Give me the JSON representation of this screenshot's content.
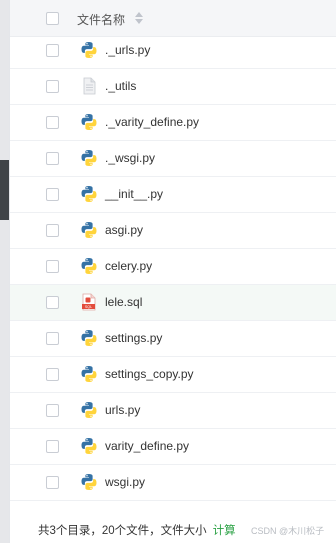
{
  "header": {
    "column_title": "文件名称"
  },
  "files": [
    {
      "name": "._urls.py",
      "type": "python"
    },
    {
      "name": "._utils",
      "type": "generic"
    },
    {
      "name": "._varity_define.py",
      "type": "python"
    },
    {
      "name": "._wsgi.py",
      "type": "python"
    },
    {
      "name": "__init__.py",
      "type": "python"
    },
    {
      "name": "asgi.py",
      "type": "python"
    },
    {
      "name": "celery.py",
      "type": "python"
    },
    {
      "name": "lele.sql",
      "type": "sql"
    },
    {
      "name": "settings.py",
      "type": "python"
    },
    {
      "name": "settings_copy.py",
      "type": "python"
    },
    {
      "name": "urls.py",
      "type": "python"
    },
    {
      "name": "varity_define.py",
      "type": "python"
    },
    {
      "name": "wsgi.py",
      "type": "python"
    }
  ],
  "footer": {
    "summary": "共3个目录，20个文件，文件大小",
    "calc_link": "计算"
  },
  "watermark": "CSDN @木川松子",
  "colors": {
    "python_blue": "#3572A5",
    "python_yellow": "#FFD43B",
    "sql_red": "#e34c3c",
    "link_green": "#2aa144"
  }
}
